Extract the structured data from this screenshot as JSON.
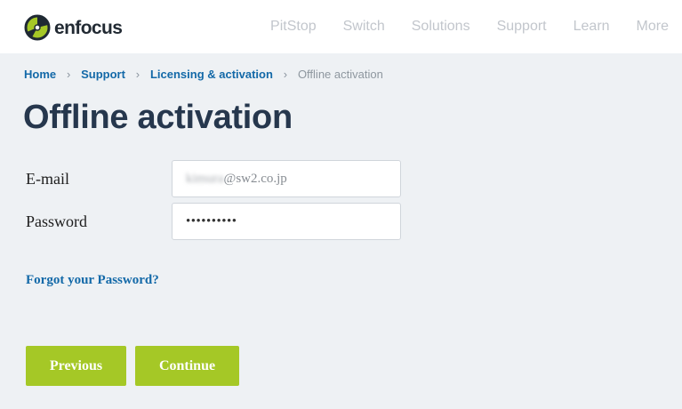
{
  "header": {
    "logo": {
      "text": "enfocus",
      "mark_color": "#a5c826"
    },
    "nav": [
      {
        "label": "PitStop"
      },
      {
        "label": "Switch"
      },
      {
        "label": "Solutions"
      },
      {
        "label": "Support"
      },
      {
        "label": "Learn"
      },
      {
        "label": "More"
      }
    ]
  },
  "breadcrumb": {
    "items": [
      "Home",
      "Support",
      "Licensing & activation"
    ],
    "current": "Offline activation",
    "separator": "›"
  },
  "page_title": "Offline activation",
  "form": {
    "email_label": "E-mail",
    "email_value_obscured": "kimura",
    "email_value_domain": "@sw2.co.jp",
    "password_label": "Password",
    "password_value": "••••••••••",
    "forgot_label": "Forgot your Password?"
  },
  "buttons": {
    "previous": "Previous",
    "continue": "Continue"
  },
  "colors": {
    "accent_green": "#a5c826",
    "link_blue": "#1369a8",
    "title_navy": "#26374d",
    "background": "#eef1f4"
  }
}
